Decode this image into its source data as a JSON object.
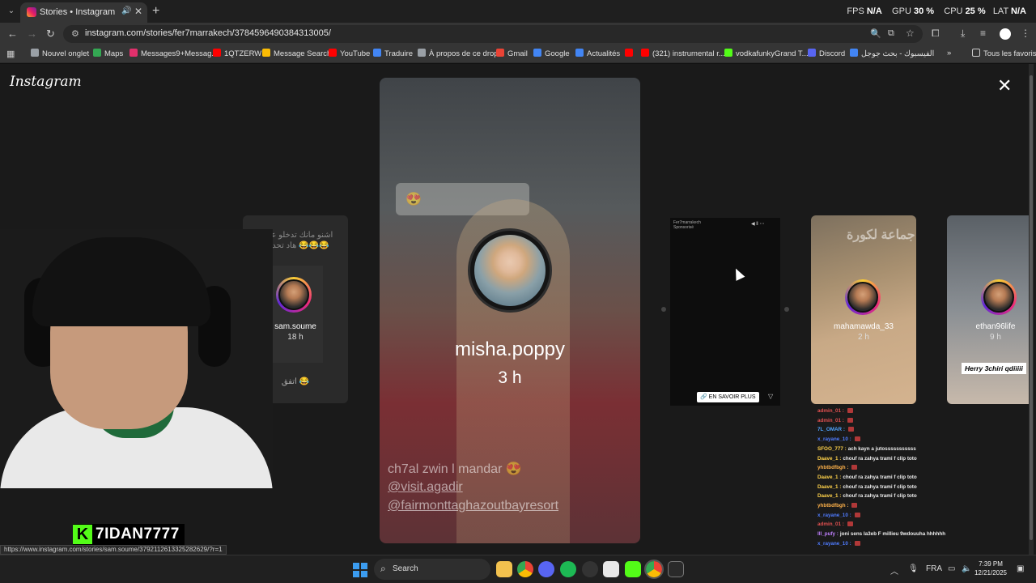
{
  "browser": {
    "tab_title": "Stories • Instagram",
    "tab_close": "✕",
    "new_tab": "+",
    "tab_list": "⌄",
    "perf": {
      "fps_label": "FPS",
      "fps_value": "N/A",
      "gpu_label": "GPU",
      "gpu_value": "30 %",
      "cpu_label": "CPU",
      "cpu_value": "25 %",
      "lat_label": "LAT",
      "lat_value": "N/A"
    },
    "url": "instagram.com/stories/fer7marrakech/3784596490384313005/"
  },
  "bookmarks": {
    "items": [
      {
        "label": "Nouvel onglet",
        "color": "#9aa0a6"
      },
      {
        "label": "Maps",
        "color": "#34a853"
      },
      {
        "label": "Messages9+Messag...",
        "color": "#e1306c"
      },
      {
        "label": "1QTZERW",
        "color": "#ff0000"
      },
      {
        "label": "Message Search",
        "color": "#fbbc05"
      },
      {
        "label": "YouTube",
        "color": "#ff0000"
      },
      {
        "label": "Traduire",
        "color": "#4285f4"
      },
      {
        "label": "À propos de ce drop",
        "color": "#9aa0a6"
      },
      {
        "label": "Gmail",
        "color": "#ea4335"
      },
      {
        "label": "Google",
        "color": "#4285f4"
      },
      {
        "label": "Actualités",
        "color": "#4285f4"
      },
      {
        "label": "",
        "color": "#ff0000"
      },
      {
        "label": "(321) instrumental r...",
        "color": "#ff0000"
      },
      {
        "label": "vodkafunkyGrand T...",
        "color": "#53fc18"
      },
      {
        "label": "Discord",
        "color": "#5865f2"
      },
      {
        "label": "الفيسبوك - بحث جوجل",
        "color": "#4285f4"
      }
    ],
    "more": "»",
    "all_favorites": "Tous les favoris"
  },
  "instagram": {
    "logo": "Instagram",
    "close": "✕",
    "main_story": {
      "username": "misha.poppy",
      "time": "3 h",
      "caption_1": "ch7al zwin l mandar 😍",
      "caption_2": "@visit.agadir",
      "caption_3": "@fairmonttaghazoutbayresort",
      "sticker": "😍"
    },
    "side_left": {
      "text": "اشنو مانك تدخلو على هاد تحدي 😂😂😂",
      "username": "sam.soume",
      "time": "18 h",
      "bottom": "اتفق 😂"
    },
    "ad_story": {
      "account": "Fer7marrakech",
      "sponsored": "Sponsorisé",
      "cta": "🔗 EN SAVOIR PLUS",
      "chevron": "▽"
    },
    "story_maha": {
      "username": "mahamawda_33",
      "time": "2 h",
      "overlay": "جماعة لكورة"
    },
    "story_ethan": {
      "username": "ethan96life",
      "time": "9 h",
      "caption": "Herry 3chiri qdiiiii"
    }
  },
  "chat": [
    {
      "user": "admin_01 :",
      "msg": "",
      "color": "#e05050",
      "emote": true
    },
    {
      "user": "admin_01 :",
      "msg": "",
      "color": "#e05050",
      "emote": true
    },
    {
      "user": "7L_OMAR :",
      "msg": "",
      "color": "#4fa3ff",
      "emote": true
    },
    {
      "user": "x_rayane_10 :",
      "msg": "",
      "color": "#4f7cff",
      "emote": true
    },
    {
      "user": "SFOO_777 :",
      "msg": "ach kayn a jutosssssssssss",
      "color": "#ffd24a",
      "emote": false
    },
    {
      "user": "Daave_1 :",
      "msg": "chouf ra zahya trami f clip toto",
      "color": "#ffd24a",
      "emote": false
    },
    {
      "user": "yhbtbdfbgh :",
      "msg": "",
      "color": "#ffb24a",
      "emote": true
    },
    {
      "user": "Daave_1 :",
      "msg": "chouf ra zahya trami f clip toto",
      "color": "#ffd24a",
      "emote": false
    },
    {
      "user": "Daave_1 :",
      "msg": "chouf ra zahya trami f clip toto",
      "color": "#ffd24a",
      "emote": false
    },
    {
      "user": "Daave_1 :",
      "msg": "chouf ra zahya trami f clip toto",
      "color": "#ffd24a",
      "emote": false
    },
    {
      "user": "yhbtbdfbgh :",
      "msg": "",
      "color": "#ffb24a",
      "emote": true
    },
    {
      "user": "x_rayane_10 :",
      "msg": "",
      "color": "#4f7cff",
      "emote": true
    },
    {
      "user": "admin_01 :",
      "msg": "",
      "color": "#e05050",
      "emote": true
    },
    {
      "user": "lll_pufy :",
      "msg": "joni sens la3eb F millieu 9wdouuha hhhhhh",
      "color": "#c080ff",
      "emote": false
    },
    {
      "user": "x_rayane_10 :",
      "msg": "",
      "color": "#4f7cff",
      "emote": true
    }
  ],
  "stream": {
    "watermark_logo": "K",
    "watermark_name": "7IDAN7777"
  },
  "status_url": "https://www.instagram.com/stories/sam.soume/3792112613325282629/?r=1",
  "taskbar": {
    "search": "Search",
    "lang": "FRA",
    "time": "7:39 PM",
    "date": "12/21/2025"
  }
}
